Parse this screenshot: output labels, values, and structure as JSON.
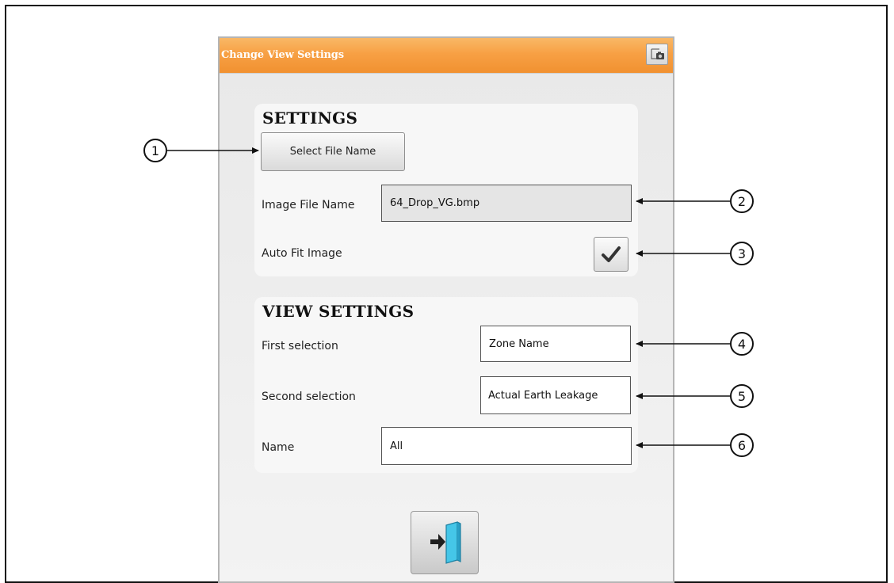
{
  "dialog": {
    "title": "Change View Settings",
    "title_button_icon": "window-camera-icon",
    "title_color": "#f7a044"
  },
  "settings": {
    "heading": "SETTINGS",
    "select_file_button": "Select File Name",
    "image_file_label": "Image File Name",
    "image_file_value": "64_Drop_VG.bmp",
    "auto_fit_label": "Auto Fit Image",
    "auto_fit_checked": true
  },
  "view_settings": {
    "heading": "VIEW SETTINGS",
    "first_label": "First selection",
    "first_value": "Zone Name",
    "second_label": "Second selection",
    "second_value": "Actual Earth Leakage",
    "name_label": "Name",
    "name_value": "All"
  },
  "exit_button_icon": "exit-door-icon",
  "callouts": [
    "1",
    "2",
    "3",
    "4",
    "5",
    "6"
  ]
}
